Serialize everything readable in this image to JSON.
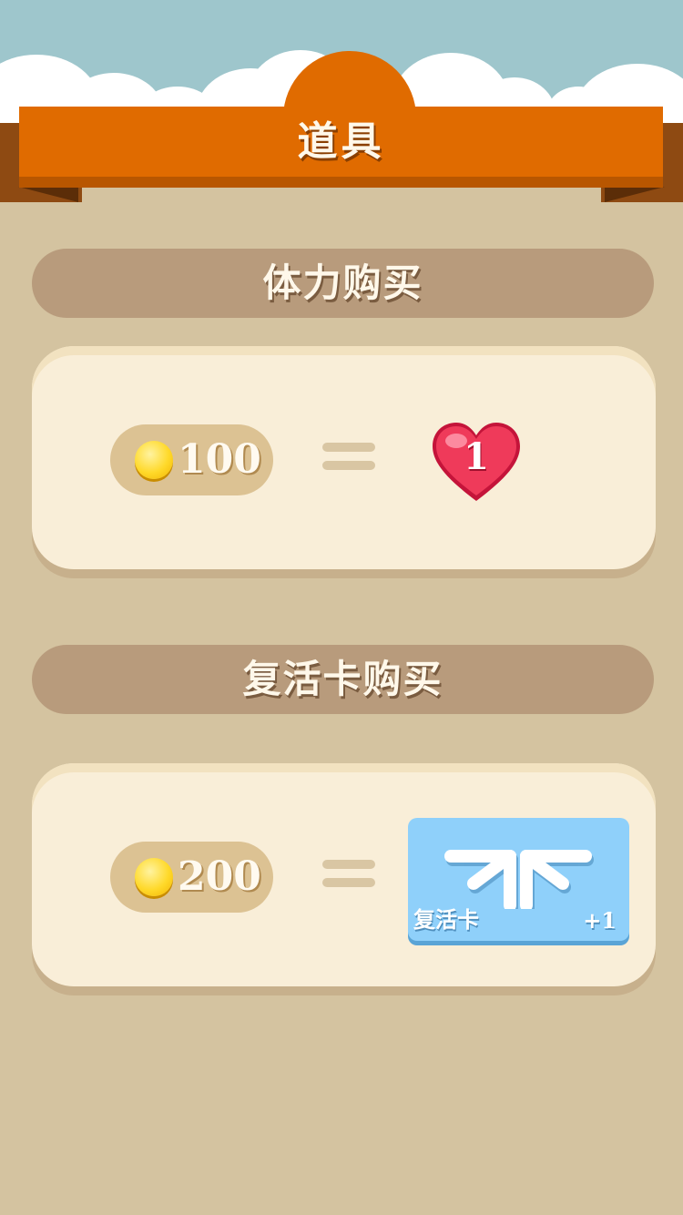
{
  "header": {
    "title": "道具"
  },
  "sections": [
    {
      "title": "体力购买",
      "price": "100",
      "reward": {
        "type": "heart",
        "value": "1"
      }
    },
    {
      "title": "复活卡购买",
      "price": "200",
      "reward": {
        "type": "revive-card",
        "label": "复活卡",
        "count": "+1"
      }
    }
  ],
  "colors": {
    "ribbon": "#e06b00",
    "background": "#d4c3a0",
    "section_bar": "#b89b7c",
    "card": "#f9eed8",
    "price_pill": "#dcc293",
    "heart": "#e8334f",
    "revive_card": "#8fd0fa"
  },
  "icons": [
    "coin-icon",
    "heart-icon",
    "revive-arrows-icon"
  ]
}
